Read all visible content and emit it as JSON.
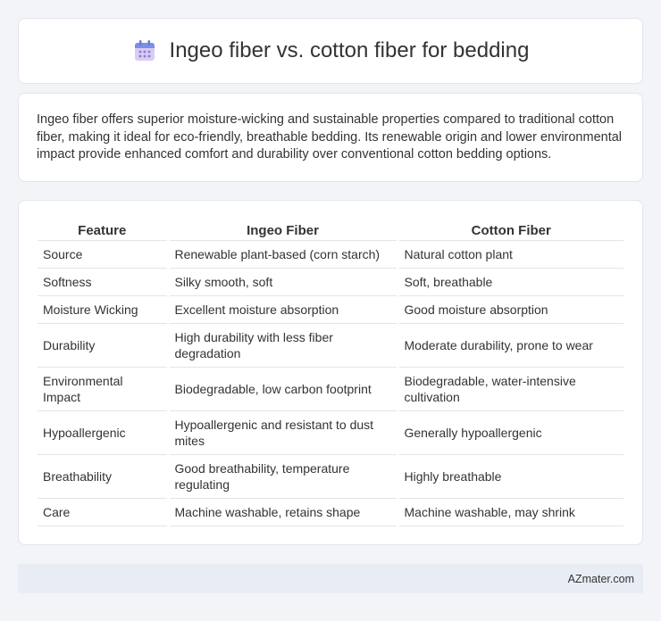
{
  "header": {
    "icon": "calendar-icon",
    "title": "Ingeo fiber vs. cotton fiber for bedding"
  },
  "intro": {
    "text": "Ingeo fiber offers superior moisture-wicking and sustainable properties compared to traditional cotton fiber, making it ideal for eco-friendly, breathable bedding. Its renewable origin and lower environmental impact provide enhanced comfort and durability over conventional cotton bedding options."
  },
  "table": {
    "headers": [
      "Feature",
      "Ingeo Fiber",
      "Cotton Fiber"
    ],
    "rows": [
      [
        "Source",
        "Renewable plant-based (corn starch)",
        "Natural cotton plant"
      ],
      [
        "Softness",
        "Silky smooth, soft",
        "Soft, breathable"
      ],
      [
        "Moisture Wicking",
        "Excellent moisture absorption",
        "Good moisture absorption"
      ],
      [
        "Durability",
        "High durability with less fiber degradation",
        "Moderate durability, prone to wear"
      ],
      [
        "Environmental Impact",
        "Biodegradable, low carbon footprint",
        "Biodegradable, water-intensive cultivation"
      ],
      [
        "Hypoallergenic",
        "Hypoallergenic and resistant to dust mites",
        "Generally hypoallergenic"
      ],
      [
        "Breathability",
        "Good breathability, temperature regulating",
        "Highly breathable"
      ],
      [
        "Care",
        "Machine washable, retains shape",
        "Machine washable, may shrink"
      ]
    ]
  },
  "footer": {
    "text": "AZmater.com"
  }
}
